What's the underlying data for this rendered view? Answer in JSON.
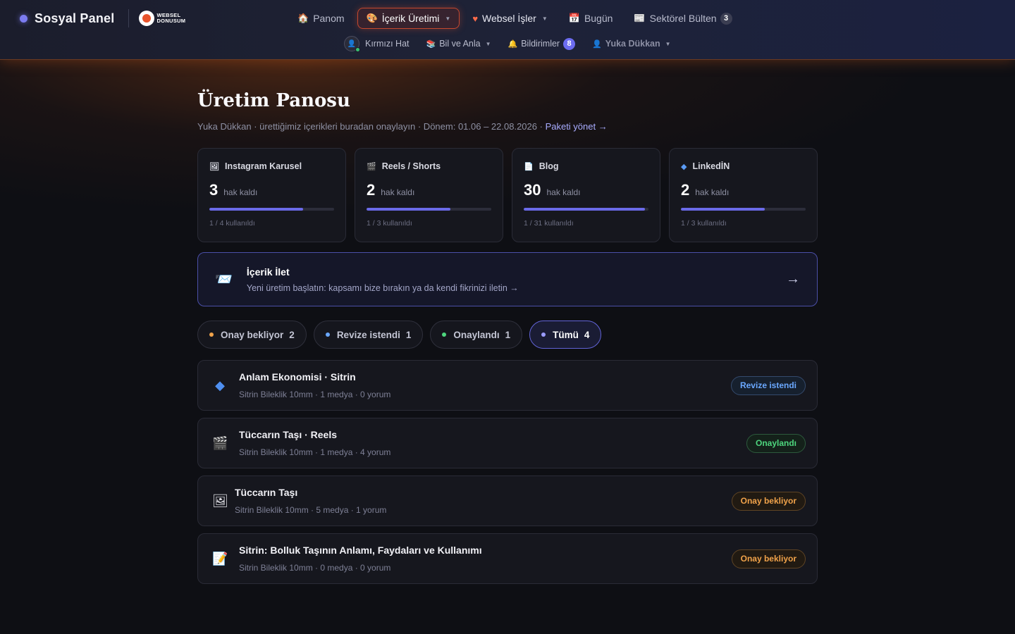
{
  "brand": {
    "name": "Sosyal Panel",
    "logo_text_1": "WEBSEL",
    "logo_text_2": "DONUSUM"
  },
  "nav": {
    "items": [
      {
        "label": "Panom",
        "icon": "home-icon"
      },
      {
        "label": "İçerik Üretimi",
        "icon": "palette-icon",
        "active": true
      },
      {
        "label": "Websel İşler",
        "icon": "heart-icon"
      },
      {
        "label": "Bugün",
        "icon": "calendar-icon"
      },
      {
        "label": "Sektörel Bülten",
        "icon": "newspaper-icon",
        "count": "3"
      }
    ],
    "secondary": [
      {
        "label": "Kırmızı Hat",
        "icon": "avatar"
      },
      {
        "label": "Bil ve Anla",
        "icon": "books-icon"
      },
      {
        "label": "Bildirimler",
        "icon": "bell-icon",
        "count": "8"
      },
      {
        "label": "Yuka Dükkan",
        "icon": "user-icon"
      }
    ]
  },
  "page": {
    "title": "Üretim Panosu",
    "subtitle": "Yuka Dükkan · ürettiğimiz içerikleri buradan onaylayın · Dönem: 01.06 – 22.08.2026 ·",
    "manage_link": "Paketi yönet →"
  },
  "quotas": [
    {
      "title": "Instagram Karusel",
      "icon": "image-icon",
      "remaining": "3",
      "remaining_label": "hak kaldı",
      "usage": "1 / 4 kullanıldı",
      "fill": 0.75
    },
    {
      "title": "Reels / Shorts",
      "icon": "clapper-icon",
      "remaining": "2",
      "remaining_label": "hak kaldı",
      "usage": "1 / 3 kullanıldı",
      "fill": 0.67
    },
    {
      "title": "Blog",
      "icon": "document-icon",
      "remaining": "30",
      "remaining_label": "hak kaldı",
      "usage": "1 / 31 kullanıldı",
      "fill": 0.97
    },
    {
      "title": "LinkedİN",
      "icon": "diamond-icon",
      "remaining": "2",
      "remaining_label": "hak kaldı",
      "usage": "1 / 3 kullanıldı",
      "fill": 0.67
    }
  ],
  "cta": {
    "title": "İçerik İlet",
    "description": "Yeni üretim başlatın: kapsamı bize bırakın ya da kendi fikrinizi iletin →",
    "arrow": "→"
  },
  "filters": [
    {
      "label": "Onay bekliyor",
      "count": "2",
      "color": "#f0a24a"
    },
    {
      "label": "Revize istendi",
      "count": "1",
      "color": "#6aa8ff"
    },
    {
      "label": "Onaylandı",
      "count": "1",
      "color": "#4ed67e"
    },
    {
      "label": "Tümü",
      "count": "4",
      "color": "#9b9cff",
      "active": true
    }
  ],
  "items": [
    {
      "title": "Anlam Ekonomisi · Sitrin",
      "meta": "Sitrin Bileklik 10mm · 1 medya · 0 yorum",
      "status": "Revize istendi",
      "icon": "diamond-icon"
    },
    {
      "title": "Tüccarın Taşı · Reels",
      "meta": "Sitrin Bileklik 10mm · 1 medya · 4 yorum",
      "status": "Onaylandı",
      "icon": "clapper-icon"
    },
    {
      "title": "Tüccarın Taşı",
      "meta": "Sitrin Bileklik 10mm · 5 medya · 1 yorum",
      "status": "Onay bekliyor",
      "icon": "image-icon"
    },
    {
      "title": "Sitrin: Bolluk Taşının Anlamı, Faydaları ve Kullanımı",
      "meta": "Sitrin Bileklik 10mm · 0 medya · 0 yorum",
      "status": "Onay bekliyor",
      "icon": "document-icon"
    }
  ],
  "colors": {
    "accent": "#6a6ae8",
    "nav_active_border": "#c5482e",
    "revize": "#6aa8ff",
    "onaylandi": "#4ed67e",
    "bekliyor": "#f0a24a"
  }
}
